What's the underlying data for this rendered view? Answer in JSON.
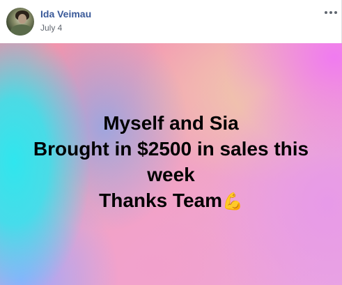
{
  "post": {
    "author": "Ida Veimau",
    "date": "July 4",
    "more_icon": "more-horizontal-icon",
    "image": {
      "text_lines": [
        "Myself and Sia",
        "Brought in $2500 in sales this",
        "week",
        "Thanks Team"
      ],
      "emoji": "💪",
      "emoji_name": "flexed-biceps-icon",
      "colors": {
        "cyan": "#2fe6ee",
        "pink": "#f48fa8",
        "magenta": "#f07bf0",
        "peach": "#f0c9a8",
        "text": "#000000"
      }
    },
    "colors": {
      "author_link": "#385898",
      "date_text": "#616770"
    }
  }
}
